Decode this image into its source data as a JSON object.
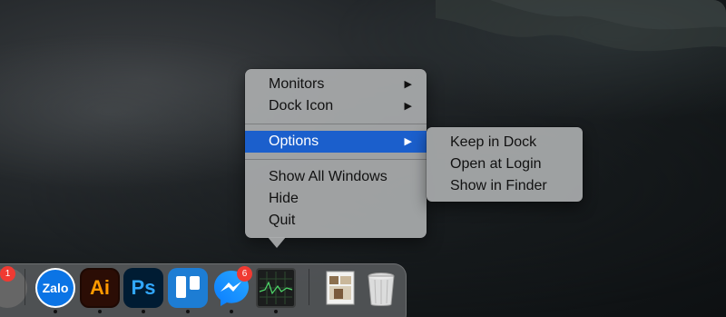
{
  "context_menu": {
    "items": [
      {
        "label": "Monitors",
        "has_submenu": true
      },
      {
        "label": "Dock Icon",
        "has_submenu": true
      },
      {
        "label": "Options",
        "has_submenu": true,
        "selected": true
      },
      {
        "label": "Show All Windows"
      },
      {
        "label": "Hide"
      },
      {
        "label": "Quit"
      }
    ],
    "arrow_glyph": "▶",
    "highlight_color": "#1b5fcc"
  },
  "submenu": {
    "items": [
      {
        "label": "Keep in Dock"
      },
      {
        "label": "Open at Login"
      },
      {
        "label": "Show in Finder"
      }
    ]
  },
  "dock": {
    "apps": [
      {
        "name": "system-preferences",
        "badge": "1",
        "running": false
      },
      {
        "name": "zalo",
        "label": "Zalo",
        "running": true
      },
      {
        "name": "adobe-illustrator",
        "label": "Ai",
        "running": true
      },
      {
        "name": "adobe-photoshop",
        "label": "Ps",
        "running": true
      },
      {
        "name": "trello",
        "running": true
      },
      {
        "name": "messenger",
        "badge": "6",
        "running": true
      },
      {
        "name": "activity-monitor",
        "running": true
      }
    ],
    "documents": [
      {
        "name": "preview-image"
      },
      {
        "name": "trash"
      }
    ]
  }
}
